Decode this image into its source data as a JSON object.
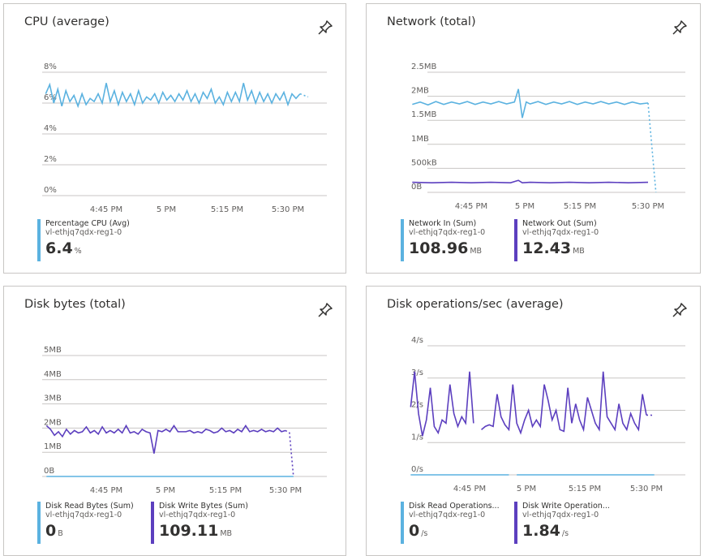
{
  "colors": {
    "light_blue": "#5bb2e0",
    "purple": "#5c3fbf",
    "grid": "#c8c6c4",
    "axis_text": "#605e5c"
  },
  "icons": {
    "pin": "pin-icon"
  },
  "tiles": [
    {
      "title": "CPU (average)",
      "legend": [
        {
          "name": "Percentage CPU (Avg)",
          "resource": "vl-ethjq7qdx-reg1-0",
          "value": "6.4",
          "unit": "%",
          "color": "#5bb2e0"
        }
      ]
    },
    {
      "title": "Network (total)",
      "legend": [
        {
          "name": "Network In (Sum)",
          "resource": "vl-ethjq7qdx-reg1-0",
          "value": "108.96",
          "unit": "MB",
          "color": "#5bb2e0"
        },
        {
          "name": "Network Out (Sum)",
          "resource": "vl-ethjq7qdx-reg1-0",
          "value": "12.43",
          "unit": "MB",
          "color": "#5c3fbf"
        }
      ]
    },
    {
      "title": "Disk bytes (total)",
      "legend": [
        {
          "name": "Disk Read Bytes (Sum)",
          "resource": "vl-ethjq7qdx-reg1-0",
          "value": "0",
          "unit": "B",
          "color": "#5bb2e0"
        },
        {
          "name": "Disk Write Bytes (Sum)",
          "resource": "vl-ethjq7qdx-reg1-0",
          "value": "109.11",
          "unit": "MB",
          "color": "#5c3fbf"
        }
      ]
    },
    {
      "title": "Disk operations/sec (average)",
      "legend": [
        {
          "name": "Disk Read Operations...",
          "resource": "vl-ethjq7qdx-reg1-0",
          "value": "0",
          "unit": "/s",
          "color": "#5bb2e0"
        },
        {
          "name": "Disk Write Operation...",
          "resource": "vl-ethjq7qdx-reg1-0",
          "value": "1.84",
          "unit": "/s",
          "color": "#5c3fbf"
        }
      ]
    }
  ],
  "chart_data": [
    {
      "type": "line",
      "title": "CPU (average)",
      "y_ticks": [
        "0%",
        "2%",
        "4%",
        "6%",
        "8%"
      ],
      "ylim": [
        0,
        8
      ],
      "x_ticks": [
        "4:45 PM",
        "5 PM",
        "5:15 PM",
        "5:30 PM"
      ],
      "x_tick_minutes": [
        45,
        60,
        75,
        90
      ],
      "grid": true,
      "series": [
        {
          "name": "Percentage CPU (Avg)",
          "color": "#5bb2e0",
          "x_minutes": [
            30,
            31,
            32,
            33,
            34,
            35,
            36,
            37,
            38,
            39,
            40,
            41,
            42,
            43,
            44,
            45,
            46,
            47,
            48,
            49,
            50,
            51,
            52,
            53,
            54,
            55,
            56,
            57,
            58,
            59,
            60,
            61,
            62,
            63,
            64,
            65,
            66,
            67,
            68,
            69,
            70,
            71,
            72,
            73,
            74,
            75,
            76,
            77,
            78,
            79,
            80,
            81,
            82,
            83,
            84,
            85,
            86,
            87,
            88,
            89,
            90,
            91,
            92,
            93,
            94,
            95
          ],
          "values": [
            6.6,
            7.2,
            6.0,
            6.9,
            5.8,
            6.8,
            6.1,
            6.5,
            5.8,
            6.6,
            5.9,
            6.3,
            6.1,
            6.6,
            6.0,
            7.3,
            6.1,
            6.8,
            5.9,
            6.7,
            6.1,
            6.6,
            5.9,
            6.8,
            6.0,
            6.4,
            6.2,
            6.6,
            6.0,
            6.7,
            6.2,
            6.5,
            6.1,
            6.6,
            6.2,
            6.8,
            6.1,
            6.6,
            6.0,
            6.7,
            6.3,
            6.9,
            6.0,
            6.4,
            5.9,
            6.7,
            6.1,
            6.7,
            6.1,
            7.3,
            6.2,
            6.8,
            6.0,
            6.7,
            6.1,
            6.6,
            6.0,
            6.6,
            6.2,
            6.7,
            5.9,
            6.6,
            6.3,
            6.6,
            null,
            6.4
          ],
          "dashed_from_index": 63
        }
      ]
    },
    {
      "type": "line",
      "title": "Network (total)",
      "y_ticks": [
        "0B",
        "500kB",
        "1MB",
        "1.5MB",
        "2MB",
        "2.5MB"
      ],
      "ylim": [
        0,
        2.5
      ],
      "y_unit": "MB",
      "x_ticks": [
        "4:45 PM",
        "5 PM",
        "5:15 PM",
        "5:30 PM"
      ],
      "x_tick_minutes": [
        45,
        60,
        75,
        90
      ],
      "grid": true,
      "series": [
        {
          "name": "Network In (Sum)",
          "color": "#5bb2e0",
          "x_minutes": [
            30,
            32,
            34,
            36,
            38,
            40,
            42,
            44,
            46,
            48,
            50,
            52,
            54,
            56,
            57,
            58,
            59,
            60,
            62,
            64,
            66,
            68,
            70,
            72,
            74,
            76,
            78,
            80,
            82,
            84,
            86,
            88,
            90,
            92
          ],
          "values": [
            1.83,
            1.88,
            1.82,
            1.89,
            1.83,
            1.88,
            1.84,
            1.89,
            1.83,
            1.88,
            1.84,
            1.89,
            1.84,
            1.88,
            2.15,
            1.55,
            1.88,
            1.84,
            1.89,
            1.83,
            1.88,
            1.84,
            1.89,
            1.83,
            1.88,
            1.84,
            1.89,
            1.84,
            1.88,
            1.83,
            1.88,
            1.84,
            1.86,
            0.0
          ],
          "dashed_from_index": 32
        },
        {
          "name": "Network Out (Sum)",
          "color": "#5c3fbf",
          "x_minutes": [
            30,
            35,
            40,
            45,
            50,
            55,
            57,
            58,
            60,
            65,
            70,
            75,
            80,
            85,
            90
          ],
          "values": [
            0.21,
            0.2,
            0.21,
            0.2,
            0.21,
            0.2,
            0.25,
            0.2,
            0.21,
            0.2,
            0.21,
            0.2,
            0.21,
            0.2,
            0.21
          ]
        }
      ]
    },
    {
      "type": "line",
      "title": "Disk bytes (total)",
      "y_ticks": [
        "0B",
        "1MB",
        "2MB",
        "3MB",
        "4MB",
        "5MB"
      ],
      "ylim": [
        0,
        5
      ],
      "y_unit": "MB",
      "x_ticks": [
        "4:45 PM",
        "5 PM",
        "5:15 PM",
        "5:30 PM"
      ],
      "x_tick_minutes": [
        45,
        60,
        75,
        90
      ],
      "grid": true,
      "series": [
        {
          "name": "Disk Read Bytes (Sum)",
          "color": "#5bb2e0",
          "x_minutes": [
            30,
            92
          ],
          "values": [
            0,
            0
          ]
        },
        {
          "name": "Disk Write Bytes (Sum)",
          "color": "#5c3fbf",
          "x_minutes": [
            30,
            31,
            32,
            33,
            34,
            35,
            36,
            37,
            38,
            39,
            40,
            41,
            42,
            43,
            44,
            45,
            46,
            47,
            48,
            49,
            50,
            51,
            52,
            53,
            54,
            55,
            56,
            57,
            58,
            59,
            60,
            61,
            62,
            63,
            64,
            65,
            66,
            67,
            68,
            69,
            70,
            71,
            72,
            73,
            74,
            75,
            76,
            77,
            78,
            79,
            80,
            81,
            82,
            83,
            84,
            85,
            86,
            87,
            88,
            89,
            90,
            91,
            92
          ],
          "values": [
            2.1,
            1.95,
            1.7,
            1.85,
            1.65,
            1.95,
            1.75,
            1.9,
            1.8,
            1.85,
            2.05,
            1.8,
            1.9,
            1.75,
            2.05,
            1.8,
            1.9,
            1.8,
            1.95,
            1.8,
            2.1,
            1.8,
            1.85,
            1.75,
            1.95,
            1.85,
            1.8,
            0.95,
            1.9,
            1.85,
            1.95,
            1.85,
            2.1,
            1.85,
            1.85,
            1.85,
            1.9,
            1.8,
            1.85,
            1.8,
            1.95,
            1.9,
            1.8,
            1.85,
            2.0,
            1.85,
            1.9,
            1.8,
            1.95,
            1.85,
            2.1,
            1.85,
            1.9,
            1.85,
            1.95,
            1.85,
            1.9,
            1.85,
            2.0,
            1.85,
            1.9,
            1.8,
            0.0
          ],
          "dashed_from_index": 60
        }
      ]
    },
    {
      "type": "line",
      "title": "Disk operations/sec (average)",
      "y_ticks": [
        "0/s",
        "1/s",
        "2/s",
        "3/s",
        "4/s"
      ],
      "ylim": [
        0,
        4
      ],
      "x_ticks": [
        "4:45 PM",
        "5 PM",
        "5:15 PM",
        "5:30 PM"
      ],
      "x_tick_minutes": [
        45,
        60,
        75,
        90
      ],
      "grid": true,
      "series": [
        {
          "name": "Disk Read Operations/Sec (Avg)",
          "color": "#5bb2e0",
          "x_minutes": [
            30,
            55,
            null,
            57,
            92
          ],
          "values": [
            0,
            0,
            null,
            0,
            0
          ]
        },
        {
          "name": "Disk Write Operations/Sec (Avg)",
          "color": "#5c3fbf",
          "x_minutes": [
            30,
            31,
            32,
            33,
            34,
            35,
            36,
            37,
            38,
            39,
            40,
            41,
            42,
            43,
            44,
            45,
            46,
            47,
            48,
            49,
            50,
            51,
            52,
            53,
            54,
            55,
            56,
            57,
            58,
            59,
            60,
            61,
            62,
            63,
            64,
            65,
            66,
            67,
            68,
            69,
            70,
            71,
            72,
            73,
            74,
            75,
            76,
            77,
            78,
            79,
            80,
            81,
            82,
            83,
            84,
            85,
            86,
            87,
            88,
            89,
            90,
            91,
            92
          ],
          "values": [
            2.1,
            3.2,
            1.9,
            1.2,
            1.7,
            2.7,
            1.5,
            1.3,
            1.7,
            1.6,
            2.8,
            1.9,
            1.5,
            1.8,
            1.6,
            3.2,
            1.6,
            null,
            1.4,
            1.5,
            1.55,
            1.5,
            2.5,
            1.8,
            1.55,
            1.4,
            2.8,
            1.6,
            1.3,
            1.7,
            2.0,
            1.5,
            1.7,
            1.5,
            2.8,
            2.3,
            1.7,
            2.0,
            1.4,
            1.35,
            2.7,
            1.6,
            2.2,
            1.7,
            1.4,
            2.4,
            2.0,
            1.6,
            1.4,
            3.2,
            1.8,
            1.6,
            1.4,
            2.2,
            1.6,
            1.4,
            1.9,
            1.6,
            1.4,
            2.5,
            1.85,
            1.85,
            1.84
          ],
          "dashed_from_index": 60
        }
      ]
    }
  ]
}
